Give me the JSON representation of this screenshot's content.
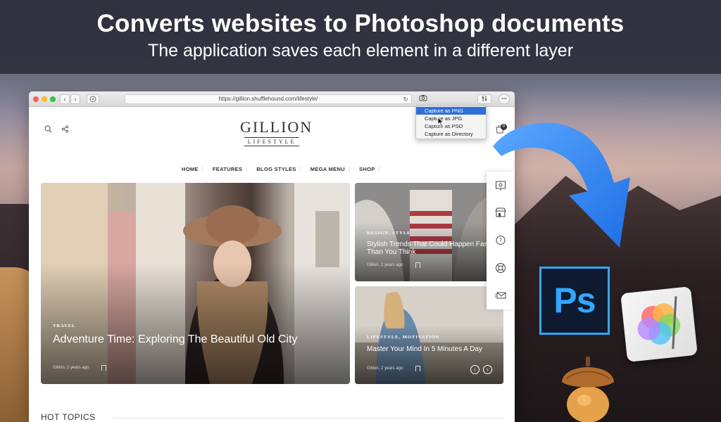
{
  "banner": {
    "headline": "Converts websites to Photoshop documents",
    "subheadline": "The application saves each element in a different layer"
  },
  "browser": {
    "url": "https://gillion.shufflehound.com/lifestyle/",
    "reload_glyph": "↻",
    "back_glyph": "‹",
    "forward_glyph": "›"
  },
  "site": {
    "logo_main": "GILLION",
    "logo_sub": "LIFESTYLE",
    "cart_count": "0",
    "nav": [
      "HOME",
      "FEATURES",
      "BLOG STYLES",
      "MEGA MENU",
      "SHOP"
    ],
    "hero": {
      "category": "TRAVEL",
      "title": "Adventure Time: Exploring The Beautiful Old City",
      "meta": "Gillion, 2 years ago"
    },
    "side_posts": [
      {
        "category": "DESIGN, STYLE",
        "title": "Stylish Trends That Could Happen Faster Than You Think",
        "meta": "Gillion, 2 years ago"
      },
      {
        "category": "LIFESTYLE, MOTIVATION",
        "title": "Master Your Mind In 5 Minutes A Day",
        "meta": "Gillion, 2 years ago"
      }
    ],
    "hot_topics": "HOT TOPICS"
  },
  "capture_menu": {
    "options": [
      "Capture as PNG",
      "Capture as JPG",
      "Capture as PSD",
      "Capture as Directory"
    ],
    "selected_index": 0
  },
  "apps": {
    "photoshop_label": "Ps"
  },
  "colors": {
    "accent_blue": "#2f80ed",
    "photoshop_blue": "#31a8ff",
    "menu_highlight": "#2f6fd8"
  }
}
